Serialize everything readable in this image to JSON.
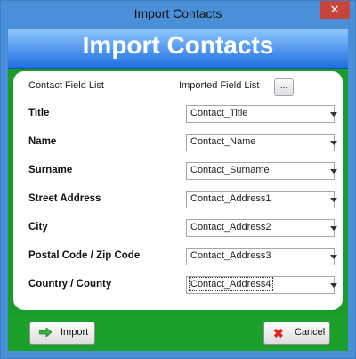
{
  "window": {
    "title": "Import Contacts",
    "close_glyph": "✕"
  },
  "banner": {
    "heading": "Import Contacts"
  },
  "header": {
    "contact_field_list": "Contact Field List",
    "imported_field_list": "Imported Field List",
    "browse_label": "..."
  },
  "rows": [
    {
      "label": "Title",
      "value": "Contact_Title"
    },
    {
      "label": "Name",
      "value": "Contact_Name"
    },
    {
      "label": "Surname",
      "value": "Contact_Surname"
    },
    {
      "label": "Street Address",
      "value": "Contact_Address1"
    },
    {
      "label": "City",
      "value": "Contact_Address2"
    },
    {
      "label": "Postal Code / Zip Code",
      "value": "Contact_Address3"
    },
    {
      "label": "Country / County",
      "value": "Contact_Address4"
    }
  ],
  "buttons": {
    "import": "Import",
    "cancel": "Cancel"
  },
  "icons": {
    "import": "arrow-right-icon",
    "cancel": "red-x-icon"
  },
  "colors": {
    "banner": "#1f6fe0",
    "footer": "#1aa02b",
    "cancel_icon": "#dd2222"
  }
}
